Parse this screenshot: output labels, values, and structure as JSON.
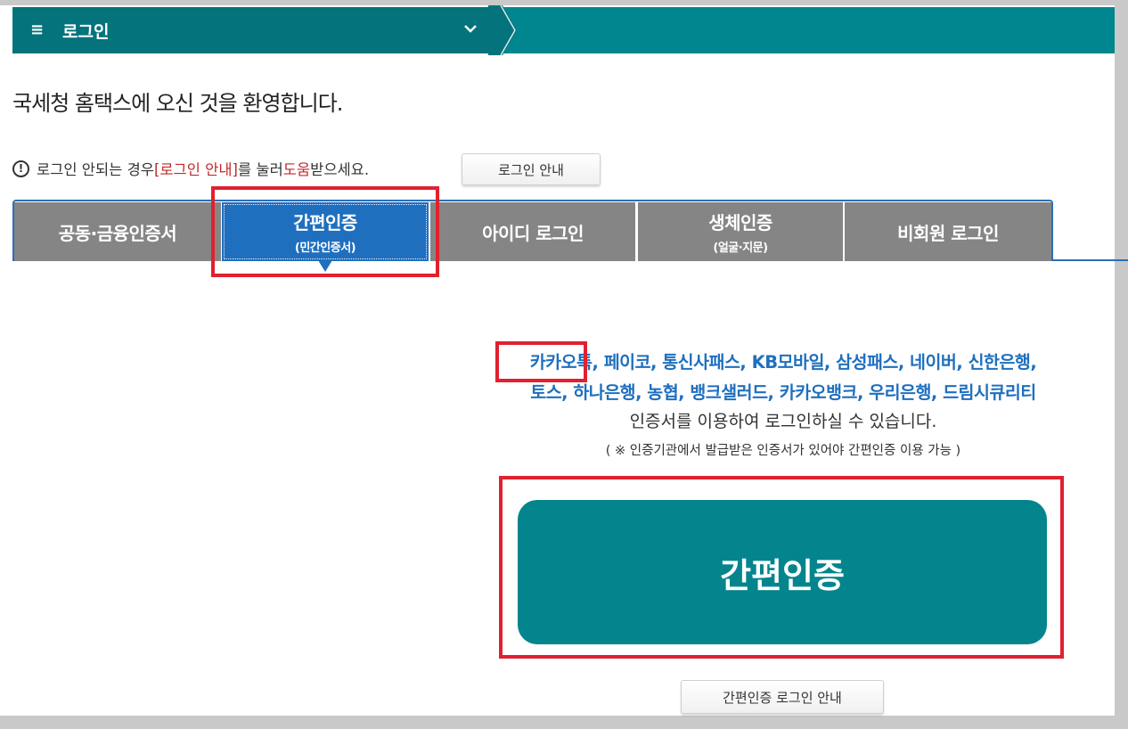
{
  "header": {
    "menu_glyph": "≡",
    "title": "로그인"
  },
  "welcome_text": "국세청 홈택스에 오신 것을 환영합니다.",
  "notice": {
    "part1": "로그인 안되는 경우 ",
    "link_label": "[로그인 안내]",
    "part2": "를 눌러 ",
    "help_word": "도움",
    "part3": "받으세요."
  },
  "login_guide_button": "로그인 안내",
  "tabs": [
    {
      "label": "공동·금융인증서",
      "sub": ""
    },
    {
      "label": "간편인증",
      "sub": "(민간인증서)"
    },
    {
      "label": "아이디 로그인",
      "sub": ""
    },
    {
      "label": "생체인증",
      "sub": "(얼굴·지문)"
    },
    {
      "label": "비회원 로그인",
      "sub": ""
    }
  ],
  "providers": {
    "first": "카카오톡,",
    "line1_rest": " 페이코, 통신사패스, KB모바일, 삼성패스, 네이버, 신한은행,",
    "line2": "토스, 하나은행, 농협, 뱅크샐러드, 카카오뱅크, 우리은행, 드림시큐리티"
  },
  "use_text": "인증서를 이용하여 로그인하실 수 있습니다.",
  "note": "( ※ 인증기관에서 발급받은 인증서가 있어야 간편인증 이용 가능 )",
  "main_button": "간편인증",
  "guide_button": "간편인증 로그인 안내",
  "colors": {
    "teal": "#00868f",
    "active_tab": "#1f6fbf",
    "highlight": "#e0212f"
  }
}
